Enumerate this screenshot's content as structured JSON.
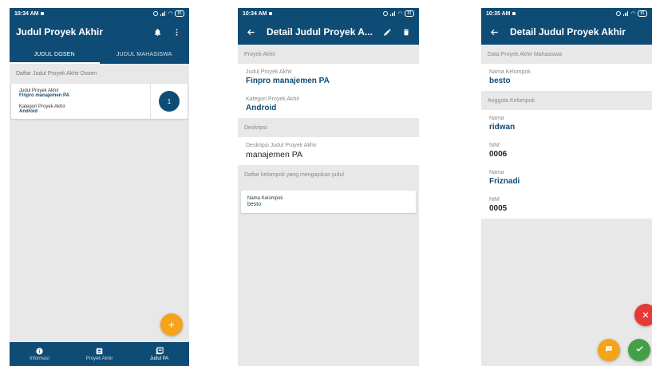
{
  "screen1": {
    "status_time": "10:34 AM",
    "status_battery": "81",
    "title": "Judul Proyek Akhir",
    "tabs": [
      {
        "label": "JUDUL DOSEN"
      },
      {
        "label": "JUDUL MAHASISWA"
      }
    ],
    "section_label": "Daftar Judul Proyek Akhir Dosen",
    "card": {
      "judul_label": "Judul Proyek Akhir",
      "judul_value": "Finpro manajemen PA",
      "kategori_label": "Kategori Proyek Akhir",
      "kategori_value": "Android",
      "count": "1"
    },
    "fab_label": "+",
    "bottom_nav": [
      {
        "label": "Informasi"
      },
      {
        "label": "Proyek Akhir"
      },
      {
        "label": "Judul PA"
      }
    ]
  },
  "screen2": {
    "status_time": "10:34 AM",
    "status_battery": "81",
    "title": "Detail Judul Proyek A...",
    "group1_head": "Proyek Akhir",
    "judul_label": "Judul Proyek Akhir",
    "judul_value": "Finpro manajemen PA",
    "kategori_label": "Kategori Proyek Akhir",
    "kategori_value": "Android",
    "group2_head": "Deskripsi",
    "deskripsi_label": "Deskripsi Judul Proyek Akhir",
    "deskripsi_value": "manajemen PA",
    "group3_head": "Daftar kelompok yang mengajukan judul",
    "kelompok_label": "Nama Kelompok",
    "kelompok_value": "besto"
  },
  "screen3": {
    "status_time": "10:35 AM",
    "status_battery": "81",
    "title": "Detail Judul Proyek Akhir",
    "group1_head": "Data Proyek Akhir Mahasiswa",
    "nama_kelompok_label": "Nama Kelompok",
    "nama_kelompok_value": "besto",
    "group2_head": "Anggota Kelompok",
    "members": [
      {
        "nama_label": "Nama",
        "nama": "ridwan",
        "nim_label": "NIM",
        "nim": "0006"
      },
      {
        "nama_label": "Nama",
        "nama": "Friznadi",
        "nim_label": "NIM",
        "nim": "0005"
      }
    ]
  },
  "colors": {
    "primary": "#0f4c75",
    "accent_orange": "#f5a31a",
    "red": "#e53935",
    "green": "#43a047",
    "background": "#e8e8e8"
  },
  "icons": [
    "bell-icon",
    "more-vert-icon",
    "back-arrow-icon",
    "edit-pencil-icon",
    "delete-trash-icon",
    "info-icon",
    "project-icon",
    "judul-list-icon",
    "close-icon",
    "chat-icon",
    "check-icon"
  ]
}
